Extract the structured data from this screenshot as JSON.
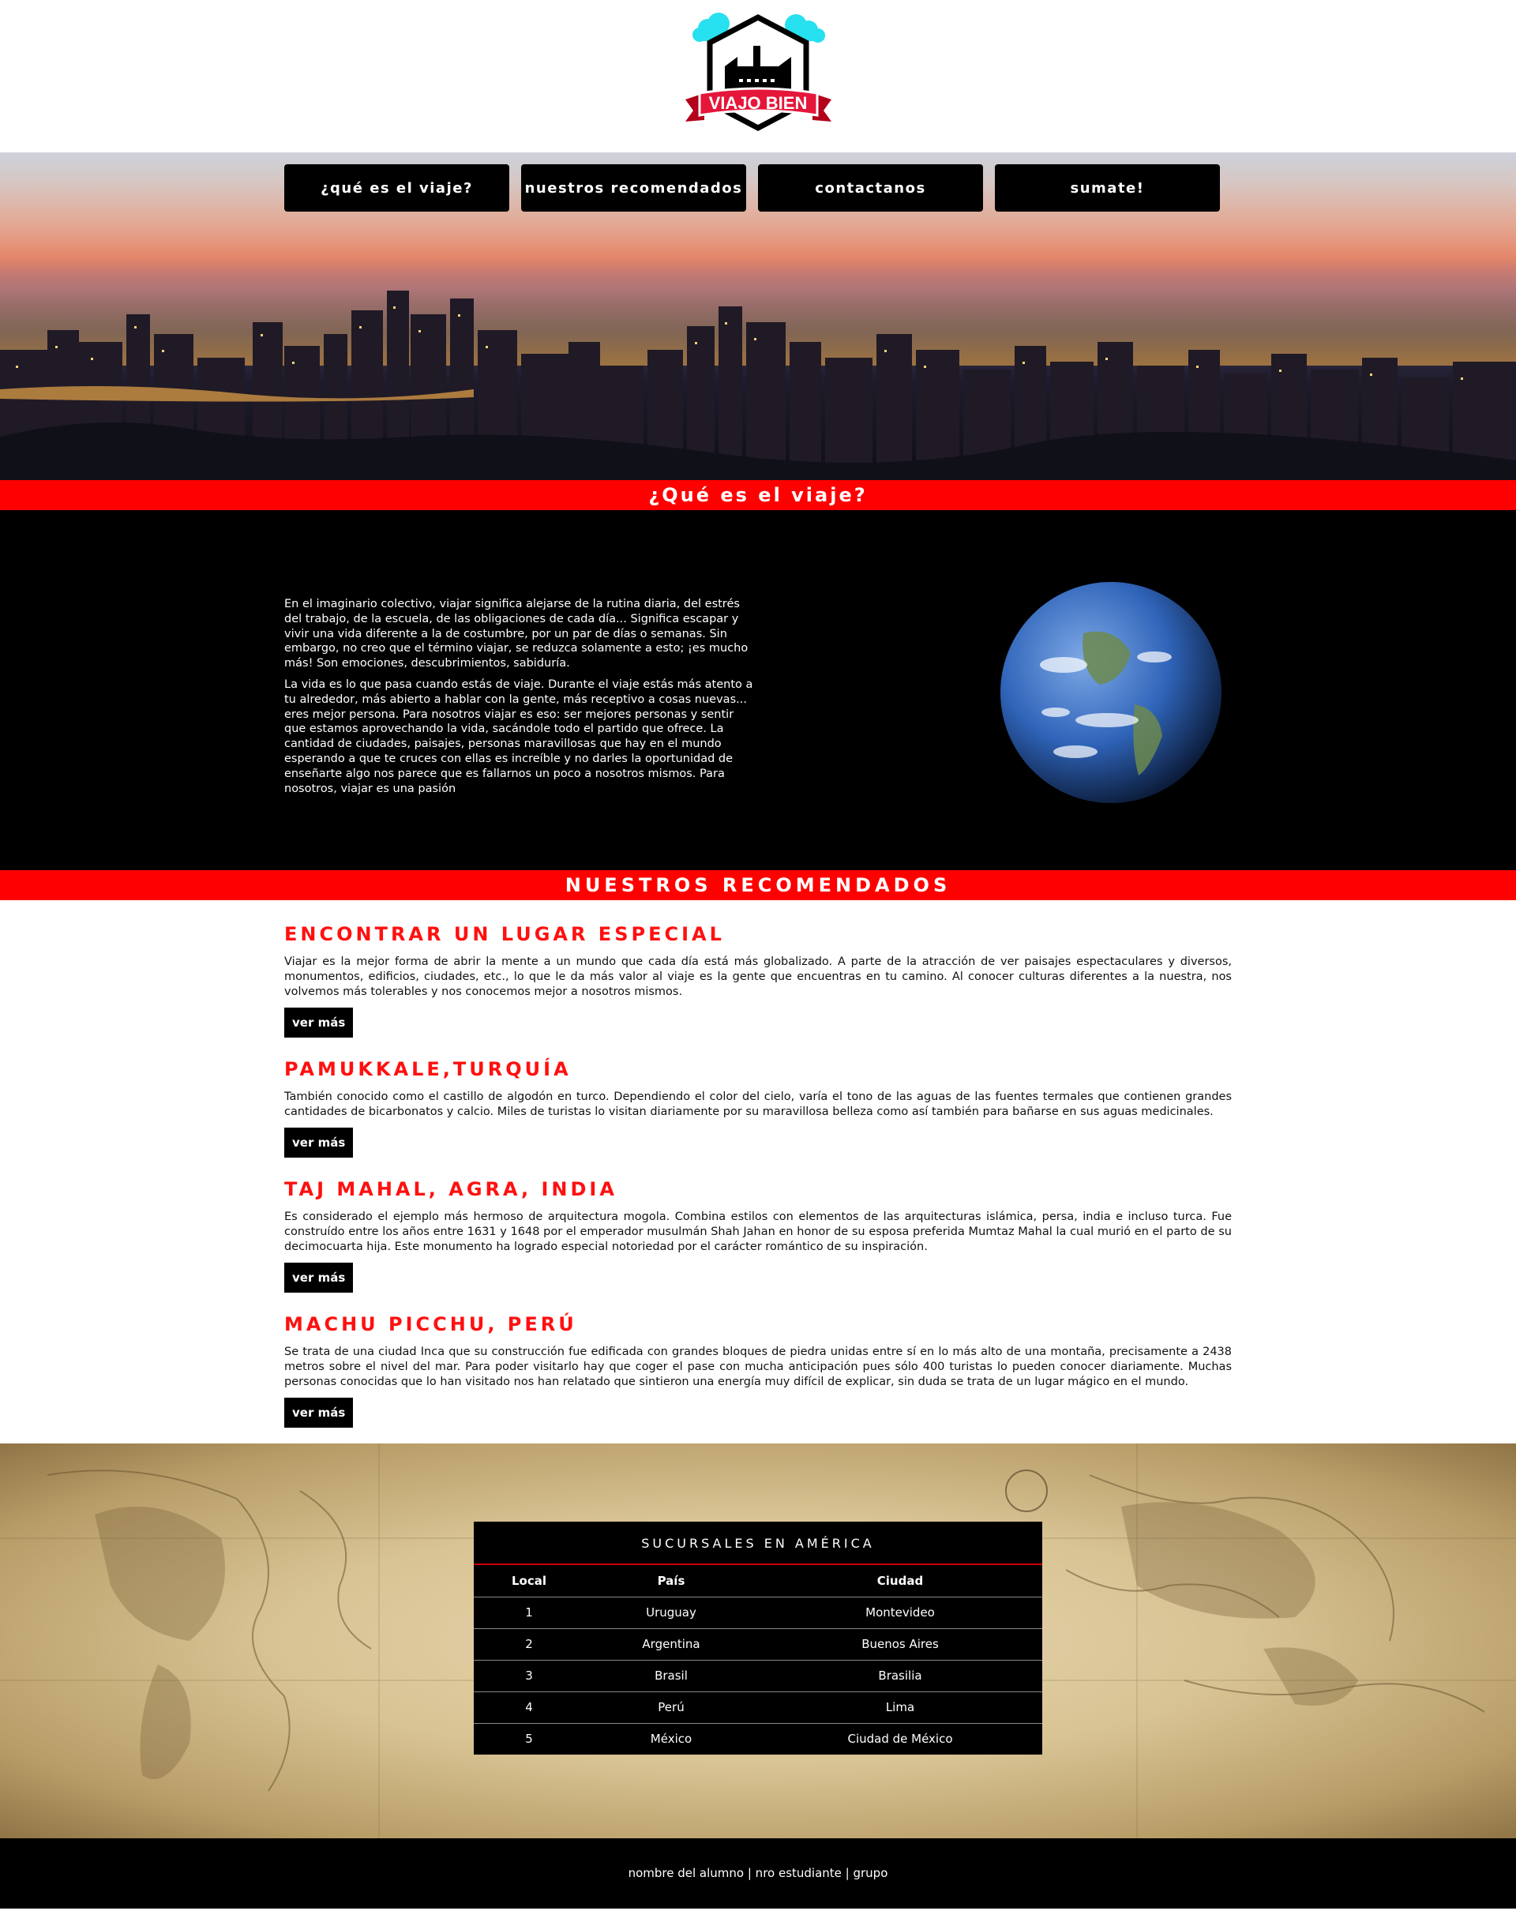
{
  "logo": {
    "text": "VIAJO BIEN"
  },
  "nav": {
    "items": [
      {
        "label": "¿qué es el viaje?"
      },
      {
        "label": "nuestros recomendados"
      },
      {
        "label": "contactanos"
      },
      {
        "label": "sumate!"
      }
    ]
  },
  "about": {
    "heading": "¿Qué es el viaje?",
    "paragraphs": [
      "En el imaginario colectivo, viajar significa alejarse de la rutina diaria, del estrés del trabajo, de la escuela, de las obligaciones de cada día... Significa escapar y vivir una vida diferente a la de costumbre, por un par de días o semanas. Sin embargo, no creo que el término viajar, se reduzca solamente a esto; ¡es mucho más! Son emociones, descubrimientos, sabiduría.",
      "La vida es lo que pasa cuando estás de viaje. Durante el viaje estás más atento a tu alrededor, más abierto a hablar con la gente, más receptivo a cosas nuevas... eres mejor persona. Para nosotros viajar es eso: ser mejores personas y sentir que estamos aprovechando la vida, sacándole todo el partido que ofrece. La cantidad de ciudades, paisajes, personas maravillosas que hay en el mundo esperando a que te cruces con ellas es increíble y no darles la oportunidad de enseñarte algo nos parece que es fallarnos un poco a nosotros mismos. Para nosotros, viajar es una pasión"
    ]
  },
  "recs": {
    "heading": "NUESTROS RECOMENDADOS",
    "button_label": "ver más",
    "items": [
      {
        "title": "ENCONTRAR UN LUGAR ESPECIAL",
        "text": "Viajar es la mejor forma de abrir la mente a un mundo que cada día está más globalizado. A parte de la atracción de ver paisajes espectaculares y diversos, monumentos, edificios, ciudades, etc., lo que le da más valor al viaje es la gente que encuentras en tu camino. Al conocer culturas diferentes a la nuestra, nos volvemos más tolerables y nos conocemos mejor a nosotros mismos."
      },
      {
        "title": "PAMUKKALE,TURQUÍA",
        "text": "También conocido como el castillo de algodón en turco. Dependiendo el color del cielo, varía el tono de las aguas de las fuentes termales que contienen grandes cantidades de bicarbonatos y calcio. Miles de turistas lo visitan diariamente por su maravillosa belleza como así también para bañarse en sus aguas medicinales."
      },
      {
        "title": "TAJ MAHAL, AGRA, INDIA",
        "text": "Es considerado el ejemplo más hermoso de arquitectura mogola. Combina estilos con elementos de las arquitecturas islámica, persa, india e incluso turca. Fue construído entre los años entre 1631 y 1648 por el emperador musulmán Shah Jahan en honor de su esposa preferida Mumtaz Mahal la cual murió en el parto de su decimocuarta hija. Este monumento ha logrado especial notoriedad por el carácter romántico de su inspiración."
      },
      {
        "title": "MACHU PICCHU, PERÚ",
        "text": "Se trata de una ciudad Inca que su construcción fue edificada con grandes bloques de piedra unidas entre sí en lo más alto de una montaña, precisamente a 2438 metros sobre el nivel del mar. Para poder visitarlo hay que coger el pase con mucha anticipación pues sólo 400 turistas lo pueden conocer diariamente. Muchas personas conocidas que lo han visitado nos han relatado que sintieron una energía muy difícil de explicar, sin duda se trata de un lugar mágico en el mundo."
      }
    ]
  },
  "branches": {
    "title": "SUCURSALES EN AMÉRICA",
    "headers": [
      "Local",
      "País",
      "Ciudad"
    ],
    "rows": [
      [
        "1",
        "Uruguay",
        "Montevideo"
      ],
      [
        "2",
        "Argentina",
        "Buenos Aires"
      ],
      [
        "3",
        "Brasil",
        "Brasilia"
      ],
      [
        "4",
        "Perú",
        "Lima"
      ],
      [
        "5",
        "México",
        "Ciudad de México"
      ]
    ]
  },
  "footer": {
    "text": "nombre del alumno | nro estudiante | grupo"
  },
  "colors": {
    "accent": "#ff0000",
    "dark": "#000000"
  }
}
